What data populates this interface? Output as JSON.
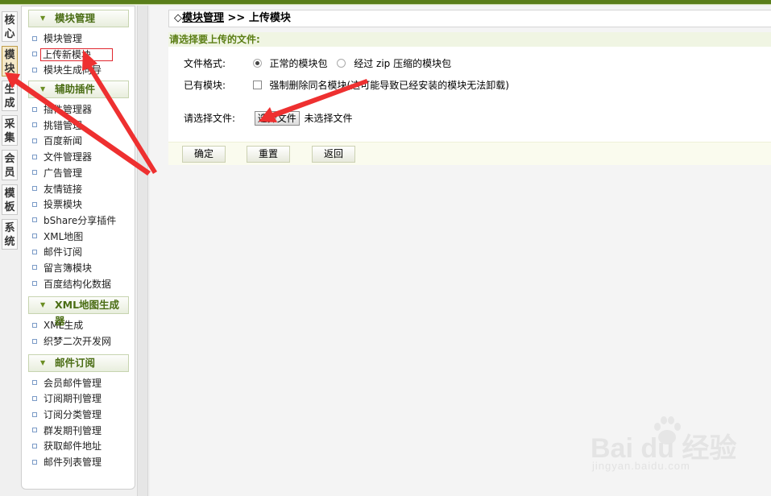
{
  "vertical_tabs": [
    "核\n心",
    "模\n块",
    "生\n成",
    "采\n集",
    "会\n员",
    "模\n板",
    "系\n统"
  ],
  "active_vertical_tab": 1,
  "menu_groups": [
    {
      "title": "模块管理",
      "items": [
        "模块管理",
        "上传新模块",
        "模块生成向导"
      ]
    },
    {
      "title": "辅助插件",
      "items": [
        "插件管理器",
        "挑错管理",
        "百度新闻",
        "文件管理器",
        "广告管理",
        "友情链接",
        "投票模块",
        "bShare分享插件",
        "XML地图",
        "邮件订阅",
        "留言簿模块",
        "百度结构化数据"
      ]
    },
    {
      "title": "XML地图生成器",
      "items": [
        "XML生成",
        "织梦二次开发网"
      ]
    },
    {
      "title": "邮件订阅",
      "items": [
        "会员邮件管理",
        "订阅期刊管理",
        "订阅分类管理",
        "群发期刊管理",
        "获取邮件地址",
        "邮件列表管理"
      ]
    }
  ],
  "breadcrumb": {
    "prefix": "◇",
    "link": "模块管理",
    "sep": " >> ",
    "current": "上传模块"
  },
  "form": {
    "title": "请选择要上传的文件:",
    "format_label": "文件格式:",
    "format_options": [
      "正常的模块包",
      "经过 zip 压缩的模块包"
    ],
    "format_selected": 0,
    "existing_label": "已有模块:",
    "existing_checkbox": "强制删除同名模块(这可能导致已经安装的模块无法卸载)",
    "file_label": "请选择文件:",
    "file_button": "选择文件",
    "file_status": "未选择文件"
  },
  "buttons": {
    "ok": "确定",
    "reset": "重置",
    "back": "返回"
  },
  "watermark": {
    "brand": "Bai du 经验",
    "url": "jingyan.baidu.com"
  },
  "colors": {
    "accent": "#5a7e1a",
    "highlight": "#e0262e"
  }
}
